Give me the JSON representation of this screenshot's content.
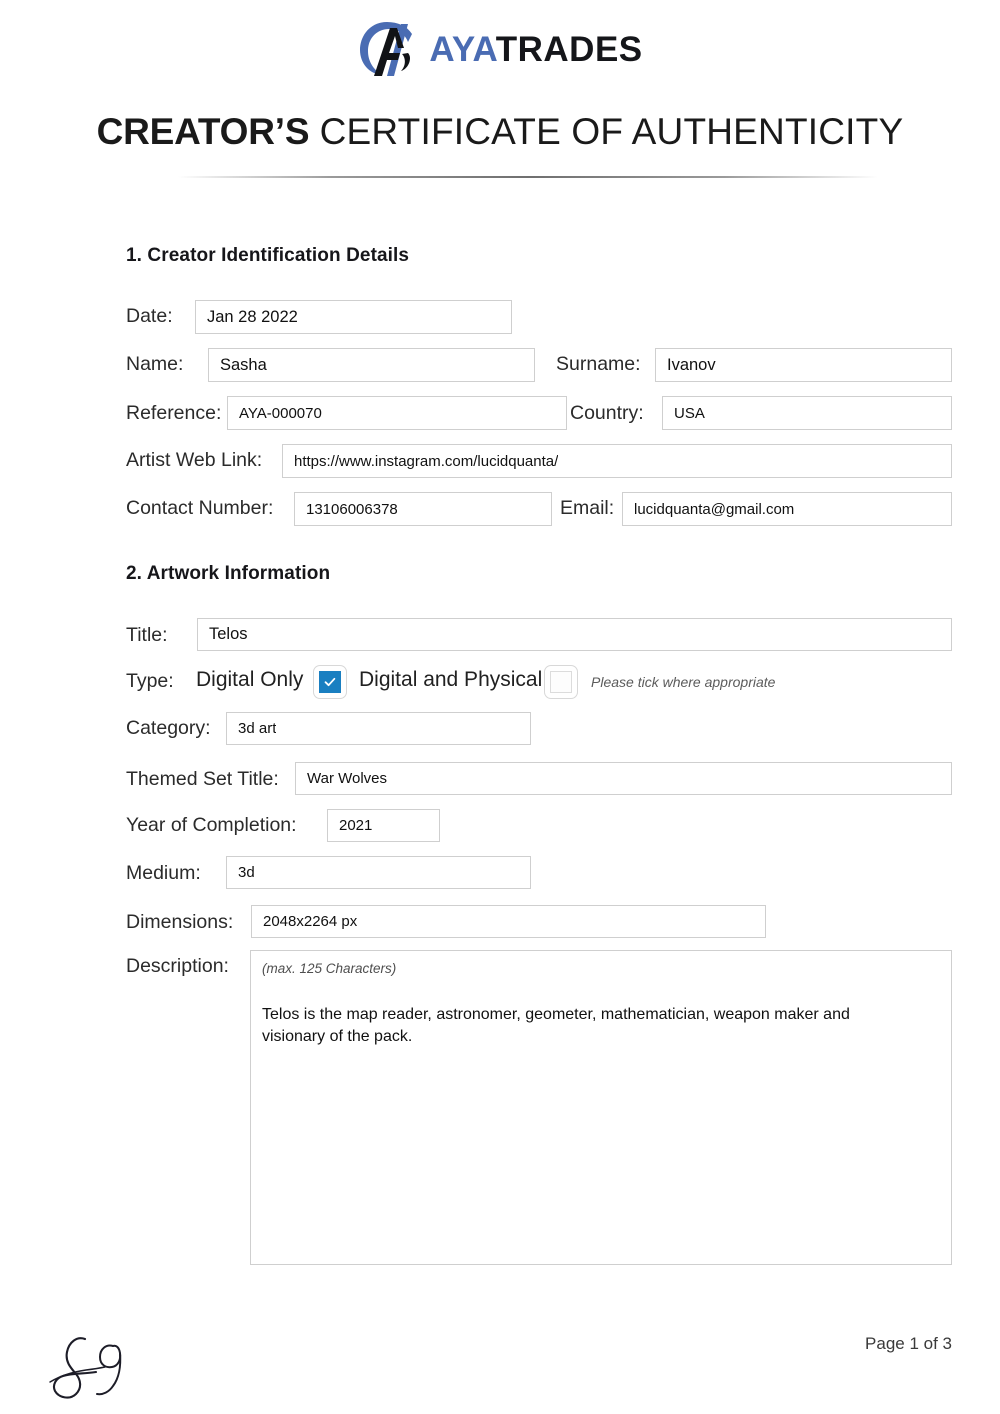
{
  "brand": {
    "name_part1": "AYA",
    "name_part2": "TRADES",
    "logo_icon": "aya-monogram-icon",
    "accent_blue": "#4a6cb3",
    "dark": "#15161a"
  },
  "document": {
    "title_strong": "CREATOR’S",
    "title_light": "CERTIFICATE OF AUTHENTICITY"
  },
  "section1": {
    "heading": "1. Creator Identification Details",
    "fields": {
      "date_label": "Date:",
      "date_value": "Jan 28 2022",
      "name_label": "Name:",
      "name_value": "Sasha",
      "surname_label": "Surname:",
      "surname_value": "Ivanov",
      "reference_label": "Reference:",
      "reference_value": "AYA-000070",
      "country_label": "Country:",
      "country_value": "USA",
      "web_link_label": "Artist Web Link:",
      "web_link_value": "https://www.instagram.com/lucidquanta/",
      "contact_label": "Contact Number:",
      "contact_value": "13106006378",
      "email_label": "Email:",
      "email_value": "lucidquanta@gmail.com"
    }
  },
  "section2": {
    "heading": "2. Artwork Information",
    "fields": {
      "title_label": "Title:",
      "title_value": "Telos",
      "type_label": "Type:",
      "type_option_1": "Digital Only",
      "type_option_2": "Digital and Physical",
      "type_hint": "Please tick where appropriate",
      "type_option_1_checked": true,
      "type_option_2_checked": false,
      "category_label": "Category:",
      "category_value": "3d art",
      "themed_set_label": "Themed Set Title:",
      "themed_set_value": "War Wolves",
      "year_label": "Year of Completion:",
      "year_value": "2021",
      "medium_label": "Medium:",
      "medium_value": "3d",
      "dimensions_label": "Dimensions:",
      "dimensions_value": "2048x2264 px",
      "description_label": "Description:",
      "description_hint": "(max. 125 Characters)",
      "description_value": "Telos is the map reader, astronomer, geometer, mathematician, weapon maker and visionary of the pack."
    }
  },
  "footer": {
    "signature_icon": "handwritten-signature-si",
    "page_number": "Page 1 of 3"
  }
}
